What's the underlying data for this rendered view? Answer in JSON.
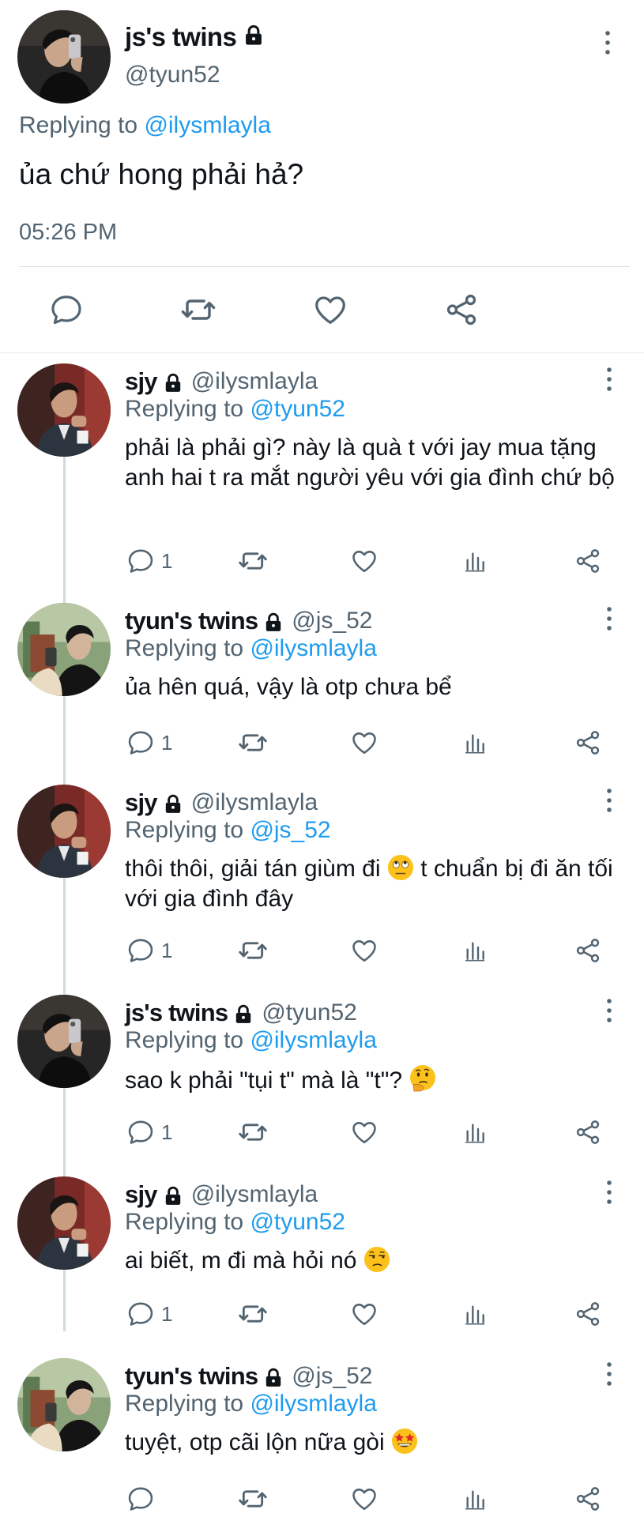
{
  "main_tweet": {
    "display_name": "js's twins",
    "handle": "@tyun52",
    "replying_prefix": "Replying to ",
    "replying_to": "@ilysmlayla",
    "text": "ủa chứ hong phải hả?",
    "time": "05:26 PM",
    "actions": [
      "reply-icon",
      "retweet-icon",
      "like-icon",
      "share-icon"
    ]
  },
  "replies": [
    {
      "display_name": "sjy",
      "handle": "@ilysmlayla",
      "replying_prefix": "Replying to ",
      "replying_to": "@tyun52",
      "text": "phải là phải gì? này là quà t với jay mua tặng anh hai t ra mắt người yêu với gia đình chứ bộ",
      "reply_count": "1"
    },
    {
      "display_name": "tyun's twins",
      "handle": "@js_52",
      "replying_prefix": "Replying to ",
      "replying_to": "@ilysmlayla",
      "text": "ủa hên quá, vậy là otp chưa bể",
      "reply_count": "1"
    },
    {
      "display_name": "sjy",
      "handle": "@ilysmlayla",
      "replying_prefix": "Replying to ",
      "replying_to": "@js_52",
      "text_before": "thôi thôi, giải tán giùm đi ",
      "emoji": "eye-roll-emoji",
      "text_after": " t chuẩn bị đi ăn tối với gia đình đây",
      "reply_count": "1"
    },
    {
      "display_name": "js's twins",
      "handle": "@tyun52",
      "replying_prefix": "Replying to ",
      "replying_to": "@ilysmlayla",
      "text_before": "sao k phải \"tụi t\" mà là \"t\"? ",
      "emoji": "thinking-emoji",
      "reply_count": "1"
    },
    {
      "display_name": "sjy",
      "handle": "@ilysmlayla",
      "replying_prefix": "Replying to ",
      "replying_to": "@tyun52",
      "text_before": "ai biết, m đi mà hỏi nó ",
      "emoji": "unamused-emoji",
      "reply_count": "1"
    },
    {
      "display_name": "tyun's twins",
      "handle": "@js_52",
      "replying_prefix": "Replying to ",
      "replying_to": "@ilysmlayla",
      "text_before": "tuyệt, otp cãi lộn nữa gòi ",
      "emoji": "star-struck-emoji",
      "reply_count": ""
    }
  ],
  "colors": {
    "link": "#1d9bf0",
    "secondary_text": "#536471",
    "primary_text": "#0f1419",
    "divider": "#d8dee3"
  }
}
